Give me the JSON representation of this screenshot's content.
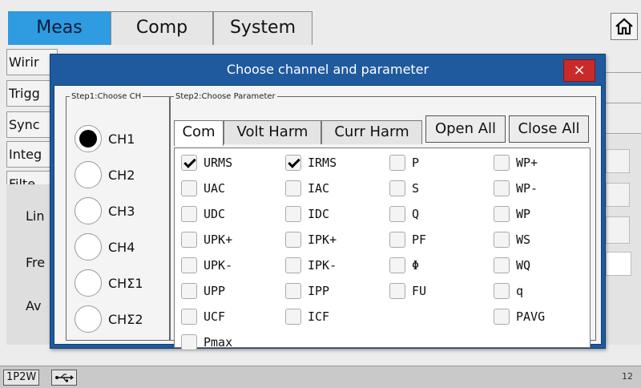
{
  "top_tabs": [
    {
      "label": "Meas",
      "active": true
    },
    {
      "label": "Comp",
      "active": false
    },
    {
      "label": "System",
      "active": false
    }
  ],
  "home_icon": "home-icon",
  "side_menu": [
    "Wirir",
    "Trigg",
    "Sync",
    "Integ",
    "Filte"
  ],
  "bg_labels": [
    "Lin",
    "Fre",
    "Av"
  ],
  "dialog": {
    "title": "Choose channel and parameter",
    "close_label": "×",
    "step1_title": "Step1:Choose CH",
    "step2_title": "Step2:Choose Parameter",
    "channels": [
      {
        "label": "CH1",
        "selected": true
      },
      {
        "label": "CH2",
        "selected": false
      },
      {
        "label": "CH3",
        "selected": false
      },
      {
        "label": "CH4",
        "selected": false
      },
      {
        "label": "CHΣ1",
        "selected": false
      },
      {
        "label": "CHΣ2",
        "selected": false
      }
    ],
    "sub_tabs": [
      {
        "label": "Com",
        "active": true
      },
      {
        "label": "Volt Harm",
        "active": false
      },
      {
        "label": "Curr Harm",
        "active": false
      }
    ],
    "open_all": "Open All",
    "close_all": "Close All",
    "params": [
      {
        "label": "URMS",
        "checked": true
      },
      {
        "label": "IRMS",
        "checked": true
      },
      {
        "label": "P",
        "checked": false
      },
      {
        "label": "WP+",
        "checked": false
      },
      {
        "label": "UAC",
        "checked": false
      },
      {
        "label": "IAC",
        "checked": false
      },
      {
        "label": "S",
        "checked": false
      },
      {
        "label": "WP-",
        "checked": false
      },
      {
        "label": "UDC",
        "checked": false
      },
      {
        "label": "IDC",
        "checked": false
      },
      {
        "label": "Q",
        "checked": false
      },
      {
        "label": "WP",
        "checked": false
      },
      {
        "label": "UPK+",
        "checked": false
      },
      {
        "label": "IPK+",
        "checked": false
      },
      {
        "label": "PF",
        "checked": false
      },
      {
        "label": "WS",
        "checked": false
      },
      {
        "label": "UPK-",
        "checked": false
      },
      {
        "label": "IPK-",
        "checked": false
      },
      {
        "label": "Φ",
        "checked": false
      },
      {
        "label": "WQ",
        "checked": false
      },
      {
        "label": "UPP",
        "checked": false
      },
      {
        "label": "IPP",
        "checked": false
      },
      {
        "label": "FU",
        "checked": false
      },
      {
        "label": "q",
        "checked": false
      },
      {
        "label": "UCF",
        "checked": false
      },
      {
        "label": "ICF",
        "checked": false
      },
      {
        "label": "PAVG",
        "checked": false
      },
      {
        "label": "Pmax",
        "checked": false
      }
    ]
  },
  "status_bar": {
    "mode": "1P2W",
    "usb_icon": "usb-icon",
    "number": "12"
  },
  "colors": {
    "accent": "#2f9be0",
    "dialog_frame": "#1f5a9e",
    "close_button": "#c92a2a"
  }
}
